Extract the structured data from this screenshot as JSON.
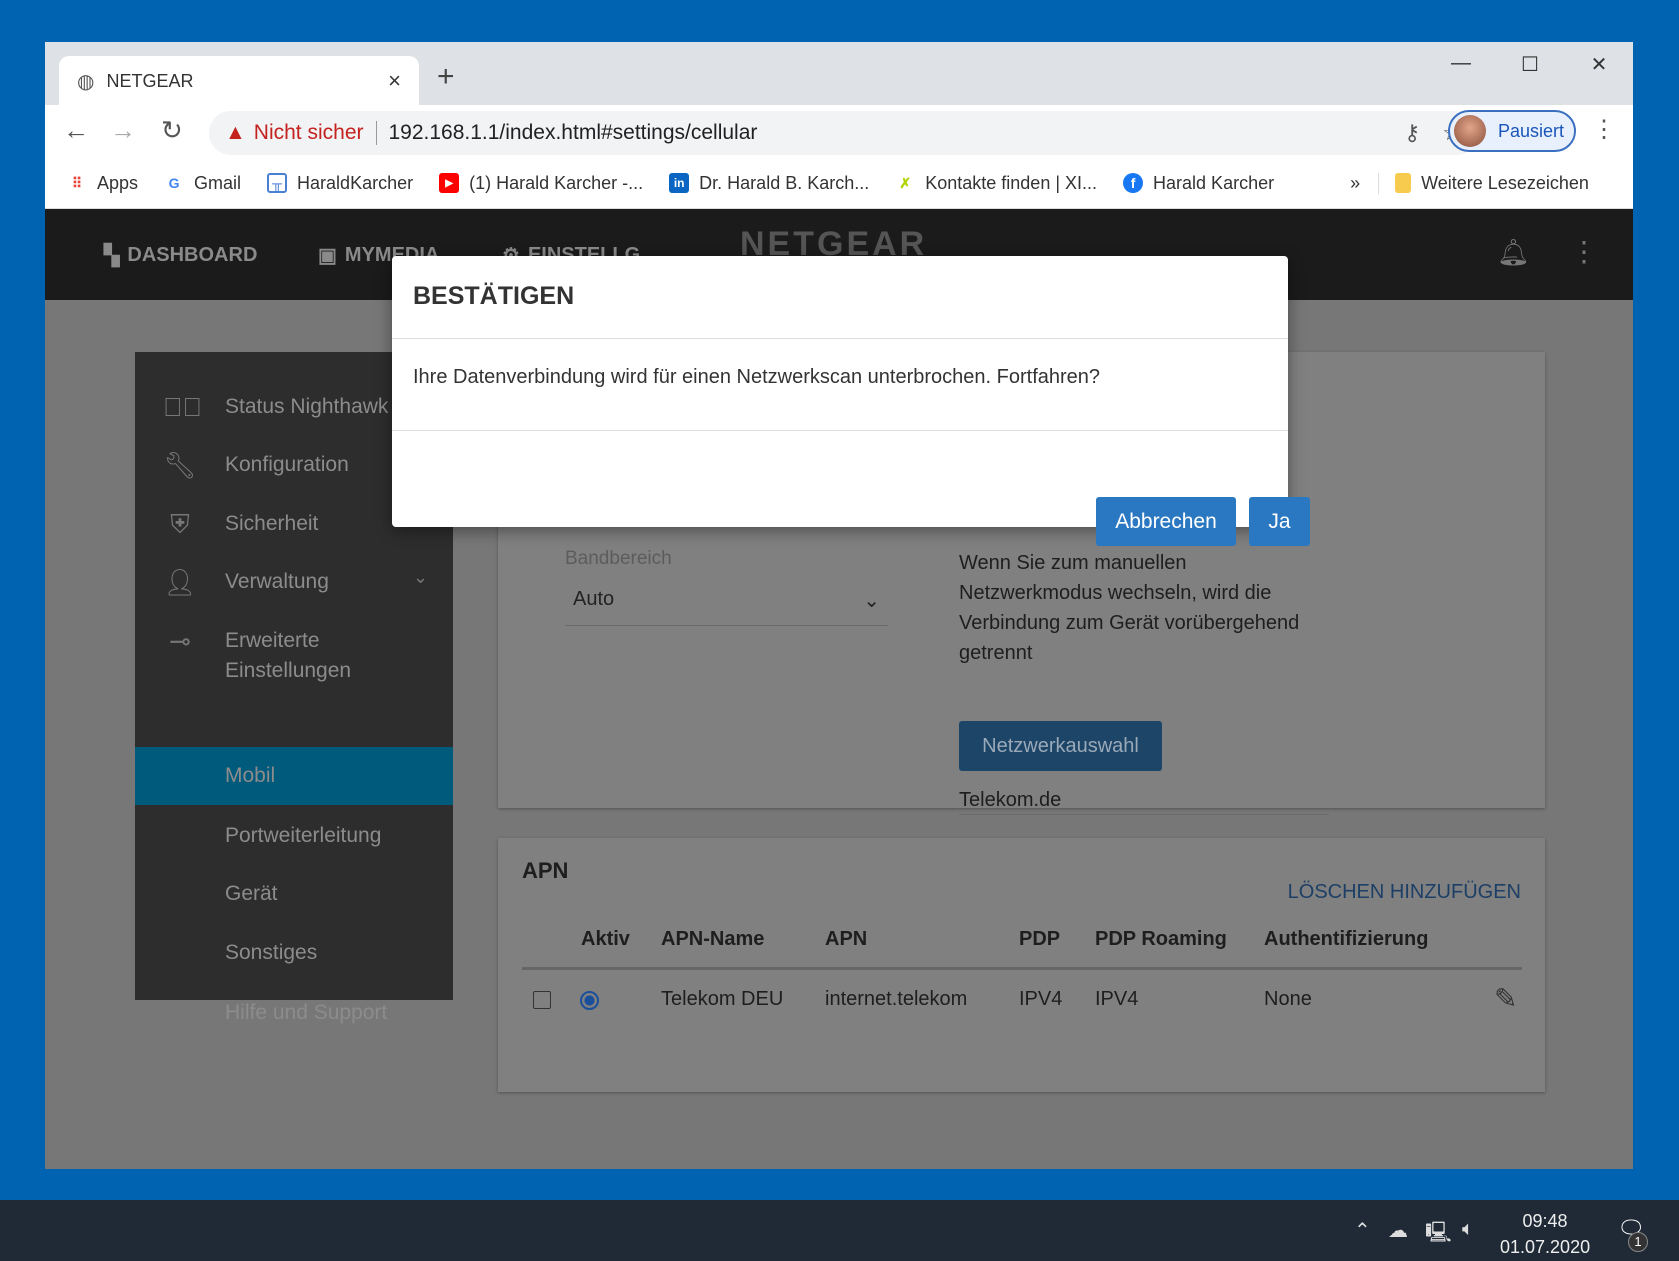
{
  "browser": {
    "tab_title": "NETGEAR",
    "new_tab": "+",
    "security_label": "Nicht sicher",
    "url": "192.168.1.1/index.html#settings/cellular",
    "profile_label": "Pausiert",
    "bookmarks": [
      "Apps",
      "Gmail",
      "HaraldKarcher",
      "(1) Harald Karcher -...",
      "Dr. Harald B. Karch...",
      "Kontakte finden | XI...",
      "Harald Karcher"
    ],
    "more": "»",
    "other_bookmarks": "Weitere Lesezeichen"
  },
  "header": {
    "nav": [
      "DASHBOARD",
      "MYMEDIA",
      "EINSTELLG"
    ],
    "logo": "NETGEAR"
  },
  "sidebar": {
    "items": [
      {
        "label": "Status Nighthawk"
      },
      {
        "label": "Konfiguration"
      },
      {
        "label": "Sicherheit"
      },
      {
        "label": "Verwaltung"
      },
      {
        "label": "Erweiterte"
      },
      {
        "label": "Einstellungen"
      },
      {
        "label": "Mobil"
      },
      {
        "label": "Portweiterleitung"
      },
      {
        "label": "Gerät"
      },
      {
        "label": "Sonstiges"
      },
      {
        "label": "Hilfe und Support"
      }
    ]
  },
  "network": {
    "band_label": "Bandbereich",
    "band_value": "Auto",
    "info_lines": [
      "Wenn Sie zum manuellen",
      "Netzwerkmodus wechseln, wird die",
      "Verbindung zum Gerät vorübergehend",
      "getrennt"
    ],
    "select_button": "Netzwerkauswahl",
    "network_name": "Telekom.de"
  },
  "apn": {
    "title": "APN",
    "actions": "LÖSCHEN HINZUFÜGEN",
    "columns": [
      "Aktiv",
      "APN-Name",
      "APN",
      "PDP",
      "PDP Roaming",
      "Authentifizierung"
    ],
    "rows": [
      {
        "name": "Telekom DEU",
        "apn": "internet.telekom",
        "pdp": "IPV4",
        "roaming": "IPV4",
        "auth": "None",
        "active": true
      }
    ]
  },
  "dialog": {
    "title": "BESTÄTIGEN",
    "message": "Ihre Datenverbindung wird für einen Netzwerkscan unterbrochen. Fortfahren?",
    "cancel": "Abbrechen",
    "confirm": "Ja"
  },
  "taskbar": {
    "time": "09:48",
    "date": "01.07.2020",
    "notifications": "1"
  }
}
